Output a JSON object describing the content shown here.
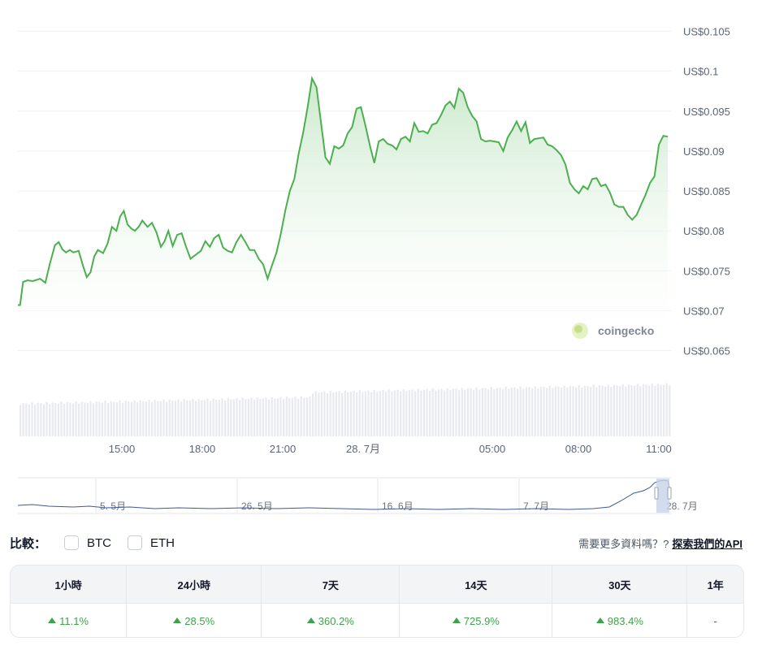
{
  "chart_data": {
    "type": "area",
    "y_axis": {
      "ticks": [
        0.065,
        0.07,
        0.075,
        0.08,
        0.085,
        0.09,
        0.095,
        0.1,
        0.105
      ],
      "tick_labels": [
        "US$0.065",
        "US$0.07",
        "US$0.075",
        "US$0.08",
        "US$0.085",
        "US$0.09",
        "US$0.095",
        "US$0.1",
        "US$0.105"
      ],
      "ylim": [
        0.0645,
        0.1065
      ]
    },
    "x_axis": {
      "tick_labels": [
        "15:00",
        "18:00",
        "21:00",
        "28. 7月",
        "05:00",
        "08:00",
        "11:00"
      ]
    },
    "grid": true,
    "series": [
      {
        "values": [
          [
            0.0705,
            0.0707
          ],
          [
            0.0708,
            0.0707
          ],
          [
            0.0712,
            0.0736
          ],
          [
            0.0718,
            0.0738
          ],
          [
            0.0725,
            0.0737
          ],
          [
            0.0735,
            0.074
          ],
          [
            0.0742,
            0.0735
          ],
          [
            0.0748,
            0.0758
          ],
          [
            0.0755,
            0.0782
          ],
          [
            0.076,
            0.0786
          ],
          [
            0.0765,
            0.0777
          ],
          [
            0.077,
            0.0773
          ],
          [
            0.0775,
            0.0776
          ],
          [
            0.078,
            0.0773
          ],
          [
            0.0787,
            0.0775
          ],
          [
            0.0793,
            0.0756
          ],
          [
            0.0798,
            0.0742
          ],
          [
            0.0803,
            0.0748
          ],
          [
            0.0808,
            0.0768
          ],
          [
            0.0813,
            0.0776
          ],
          [
            0.082,
            0.0772
          ],
          [
            0.0826,
            0.0784
          ],
          [
            0.0832,
            0.0805
          ],
          [
            0.0838,
            0.08
          ],
          [
            0.0843,
            0.0818
          ],
          [
            0.0848,
            0.0825
          ],
          [
            0.0853,
            0.0808
          ],
          [
            0.0858,
            0.0803
          ],
          [
            0.0863,
            0.08
          ],
          [
            0.0868,
            0.0805
          ],
          [
            0.0873,
            0.0813
          ],
          [
            0.088,
            0.0805
          ],
          [
            0.0886,
            0.081
          ],
          [
            0.0892,
            0.0798
          ],
          [
            0.0898,
            0.078
          ],
          [
            0.0903,
            0.0787
          ],
          [
            0.0908,
            0.08
          ],
          [
            0.0914,
            0.0781
          ],
          [
            0.092,
            0.0795
          ],
          [
            0.0926,
            0.0797
          ],
          [
            0.0932,
            0.078
          ],
          [
            0.0938,
            0.0765
          ],
          [
            0.0945,
            0.077
          ],
          [
            0.0952,
            0.0775
          ],
          [
            0.0958,
            0.0787
          ],
          [
            0.0964,
            0.078
          ],
          [
            0.097,
            0.0791
          ],
          [
            0.0976,
            0.0795
          ],
          [
            0.0982,
            0.0779
          ],
          [
            0.0988,
            0.0775
          ],
          [
            0.0994,
            0.0773
          ],
          [
            0.1,
            0.0786
          ],
          [
            0.1006,
            0.0795
          ],
          [
            0.1012,
            0.0786
          ],
          [
            0.1018,
            0.0776
          ],
          [
            0.1024,
            0.0776
          ],
          [
            0.103,
            0.0765
          ],
          [
            0.1036,
            0.0758
          ],
          [
            0.1042,
            0.074
          ],
          [
            0.1048,
            0.0757
          ],
          [
            0.1054,
            0.0773
          ],
          [
            0.106,
            0.0797
          ],
          [
            0.1066,
            0.0826
          ],
          [
            0.1072,
            0.085
          ],
          [
            0.1078,
            0.0865
          ],
          [
            0.1084,
            0.0897
          ],
          [
            0.109,
            0.0923
          ],
          [
            0.1096,
            0.0955
          ],
          [
            0.1102,
            0.0991
          ],
          [
            0.1108,
            0.098
          ],
          [
            0.1114,
            0.0936
          ],
          [
            0.112,
            0.0892
          ],
          [
            0.1126,
            0.0884
          ],
          [
            0.1132,
            0.0906
          ],
          [
            0.1138,
            0.0903
          ],
          [
            0.1144,
            0.0907
          ],
          [
            0.115,
            0.0922
          ],
          [
            0.1156,
            0.093
          ],
          [
            0.1162,
            0.0953
          ],
          [
            0.1168,
            0.0955
          ],
          [
            0.1174,
            0.0932
          ],
          [
            0.118,
            0.0907
          ],
          [
            0.1186,
            0.0885
          ],
          [
            0.1192,
            0.0912
          ],
          [
            0.1198,
            0.0915
          ],
          [
            0.1204,
            0.0909
          ],
          [
            0.121,
            0.0907
          ],
          [
            0.1216,
            0.0902
          ],
          [
            0.1222,
            0.0915
          ],
          [
            0.1228,
            0.0918
          ],
          [
            0.1234,
            0.0912
          ],
          [
            0.124,
            0.0935
          ],
          [
            0.1246,
            0.0924
          ],
          [
            0.1252,
            0.0925
          ],
          [
            0.1258,
            0.0922
          ],
          [
            0.1264,
            0.0933
          ],
          [
            0.127,
            0.0935
          ],
          [
            0.1276,
            0.0945
          ],
          [
            0.1282,
            0.0957
          ],
          [
            0.1288,
            0.0962
          ],
          [
            0.1294,
            0.0954
          ],
          [
            0.13,
            0.0978
          ],
          [
            0.1306,
            0.0973
          ],
          [
            0.1312,
            0.0955
          ],
          [
            0.1318,
            0.0944
          ],
          [
            0.1324,
            0.0937
          ],
          [
            0.133,
            0.0915
          ],
          [
            0.1336,
            0.0912
          ],
          [
            0.1342,
            0.0913
          ],
          [
            0.1348,
            0.0912
          ],
          [
            0.1354,
            0.0911
          ],
          [
            0.136,
            0.09
          ],
          [
            0.1366,
            0.0917
          ],
          [
            0.1372,
            0.0926
          ],
          [
            0.1378,
            0.0937
          ],
          [
            0.1384,
            0.0925
          ],
          [
            0.139,
            0.0936
          ],
          [
            0.1396,
            0.091
          ],
          [
            0.1402,
            0.0915
          ],
          [
            0.1408,
            0.0916
          ],
          [
            0.1414,
            0.0917
          ],
          [
            0.142,
            0.0908
          ],
          [
            0.1426,
            0.0906
          ],
          [
            0.1432,
            0.0901
          ],
          [
            0.1438,
            0.0895
          ],
          [
            0.1444,
            0.0883
          ],
          [
            0.145,
            0.086
          ],
          [
            0.1456,
            0.0852
          ],
          [
            0.1462,
            0.0847
          ],
          [
            0.1468,
            0.0856
          ],
          [
            0.1474,
            0.0852
          ],
          [
            0.148,
            0.0865
          ],
          [
            0.1486,
            0.0866
          ],
          [
            0.1492,
            0.0856
          ],
          [
            0.1498,
            0.0858
          ],
          [
            0.1504,
            0.0848
          ],
          [
            0.151,
            0.0833
          ],
          [
            0.1516,
            0.083
          ],
          [
            0.1522,
            0.083
          ],
          [
            0.1528,
            0.082
          ],
          [
            0.1534,
            0.0814
          ],
          [
            0.154,
            0.082
          ],
          [
            0.1546,
            0.0833
          ],
          [
            0.1552,
            0.0845
          ],
          [
            0.1558,
            0.086
          ],
          [
            0.1564,
            0.0868
          ],
          [
            0.157,
            0.0908
          ],
          [
            0.1576,
            0.0919
          ],
          [
            0.1582,
            0.0918
          ]
        ]
      }
    ],
    "volume_x_range": [
      0.0705,
      0.1582
    ]
  },
  "watermark": {
    "text": "coingecko"
  },
  "navigator": {
    "labels": [
      "5. 5月",
      "26. 5月",
      "16. 6月",
      "7. 7月",
      "28. 7月"
    ]
  },
  "compare": {
    "title": "比較：",
    "options": [
      {
        "label": "BTC"
      },
      {
        "label": "ETH"
      }
    ],
    "more_data": "需要更多資料嗎？?",
    "api_link": "探索我們的API"
  },
  "stats": {
    "headers": [
      "1小時",
      "24小時",
      "7天",
      "14天",
      "30天",
      "1年"
    ],
    "values": [
      "11.1%",
      "28.5%",
      "360.2%",
      "725.9%",
      "983.4%",
      "-"
    ],
    "positive_color": "#3da34a"
  },
  "colors": {
    "line": "#4caf50",
    "grid": "#eef0f3",
    "area_top": "#cfead0"
  }
}
